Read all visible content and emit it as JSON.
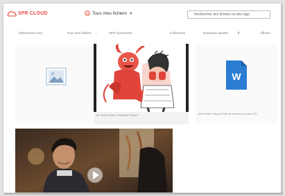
{
  "brand": {
    "name": "SFR CLOUD",
    "color": "#e6463c"
  },
  "header": {
    "folder_label": "Tous mes fichiers",
    "search_placeholder": "Rechercher des fichiers ou des tags"
  },
  "toolbar": {
    "select_all": "Sélectionner tout",
    "breadcrumb_root": "Tous mes fichiers",
    "breadcrumb_current": "SFR Cloud Drive",
    "item_count": "5 éléments",
    "sort_label": "Nouveaux ajoutés",
    "view_label": "Afficher"
  },
  "files": [
    {
      "type": "image-placeholder",
      "icon": "image-icon",
      "caption": ""
    },
    {
      "type": "illustration",
      "caption": "Mr Peach (Mar 4 Horrible) Picture..."
    },
    {
      "type": "document",
      "icon": "word-document-icon",
      "icon_letter": "W",
      "accent": "#2b7cd3",
      "caption": "Mon Partie Sage (Fiche de travail sur rendu V2)"
    },
    {
      "type": "video",
      "icon": "play-icon",
      "caption": ""
    }
  ]
}
